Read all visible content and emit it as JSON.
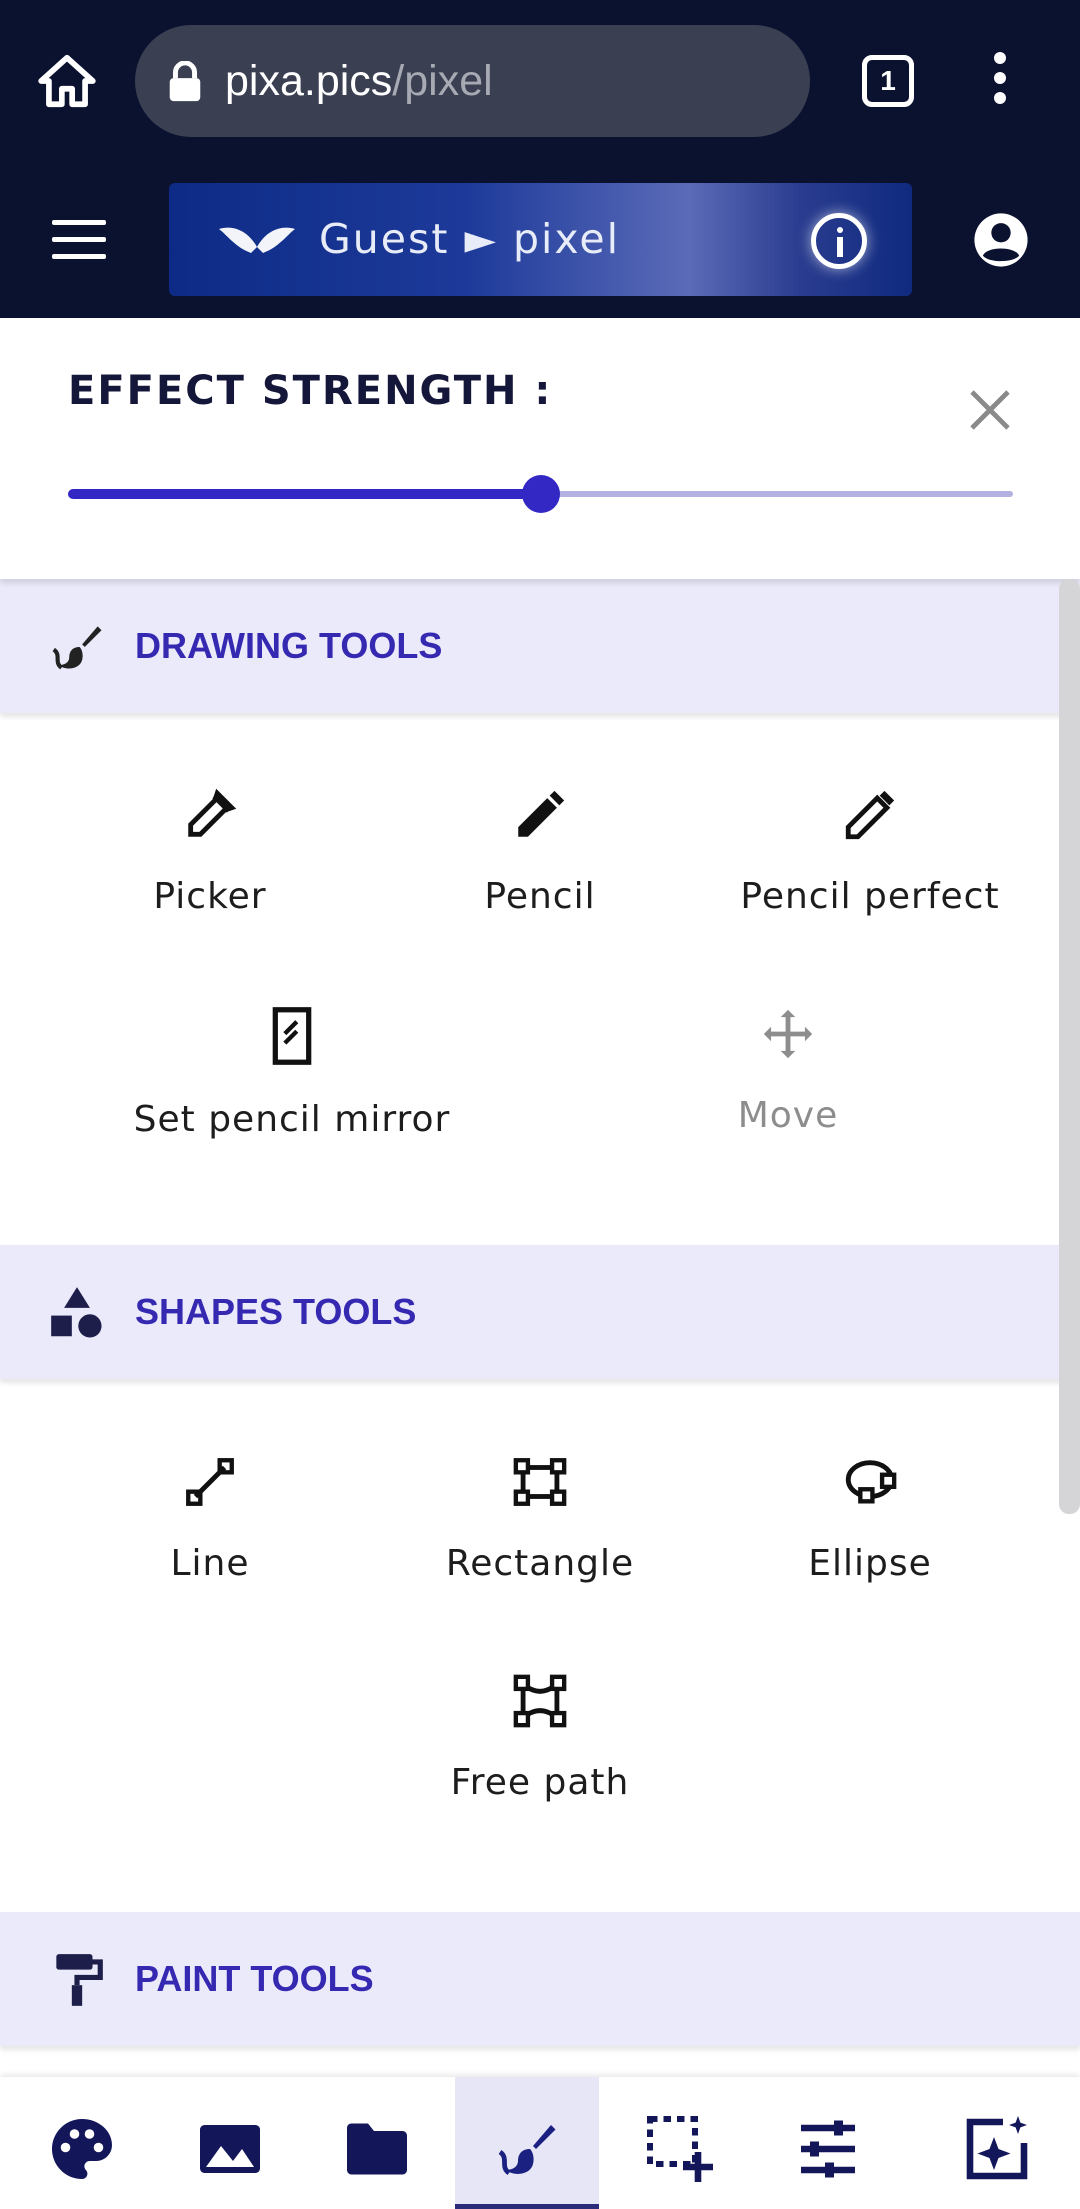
{
  "browser": {
    "url_domain": "pixa.pics",
    "url_path": "/pixel",
    "tab_count": "1"
  },
  "header": {
    "title": "Guest ► pixel"
  },
  "effect": {
    "label": "EFFECT STRENGTH :",
    "value": 0.5
  },
  "sections": {
    "drawing": {
      "title": "DRAWING TOOLS",
      "tools": [
        {
          "label": "Picker"
        },
        {
          "label": "Pencil"
        },
        {
          "label": "Pencil perfect"
        },
        {
          "label": "Set pencil mirror"
        },
        {
          "label": "Move",
          "disabled": true
        }
      ]
    },
    "shapes": {
      "title": "SHAPES TOOLS",
      "tools": [
        {
          "label": "Line"
        },
        {
          "label": "Rectangle"
        },
        {
          "label": "Ellipse"
        },
        {
          "label": "Free path"
        }
      ]
    },
    "paint": {
      "title": "PAINT TOOLS"
    }
  },
  "bottom_nav": {
    "items": [
      "palette-icon",
      "image-icon",
      "folder-icon",
      "brush-icon",
      "selection-add-icon",
      "tune-icon",
      "effects-icon"
    ],
    "active": "brush-icon"
  },
  "colors": {
    "header_bg": "#0b1230",
    "accent": "#3428c4",
    "section_bg": "#ebeafb",
    "section_title": "#3528b1"
  }
}
